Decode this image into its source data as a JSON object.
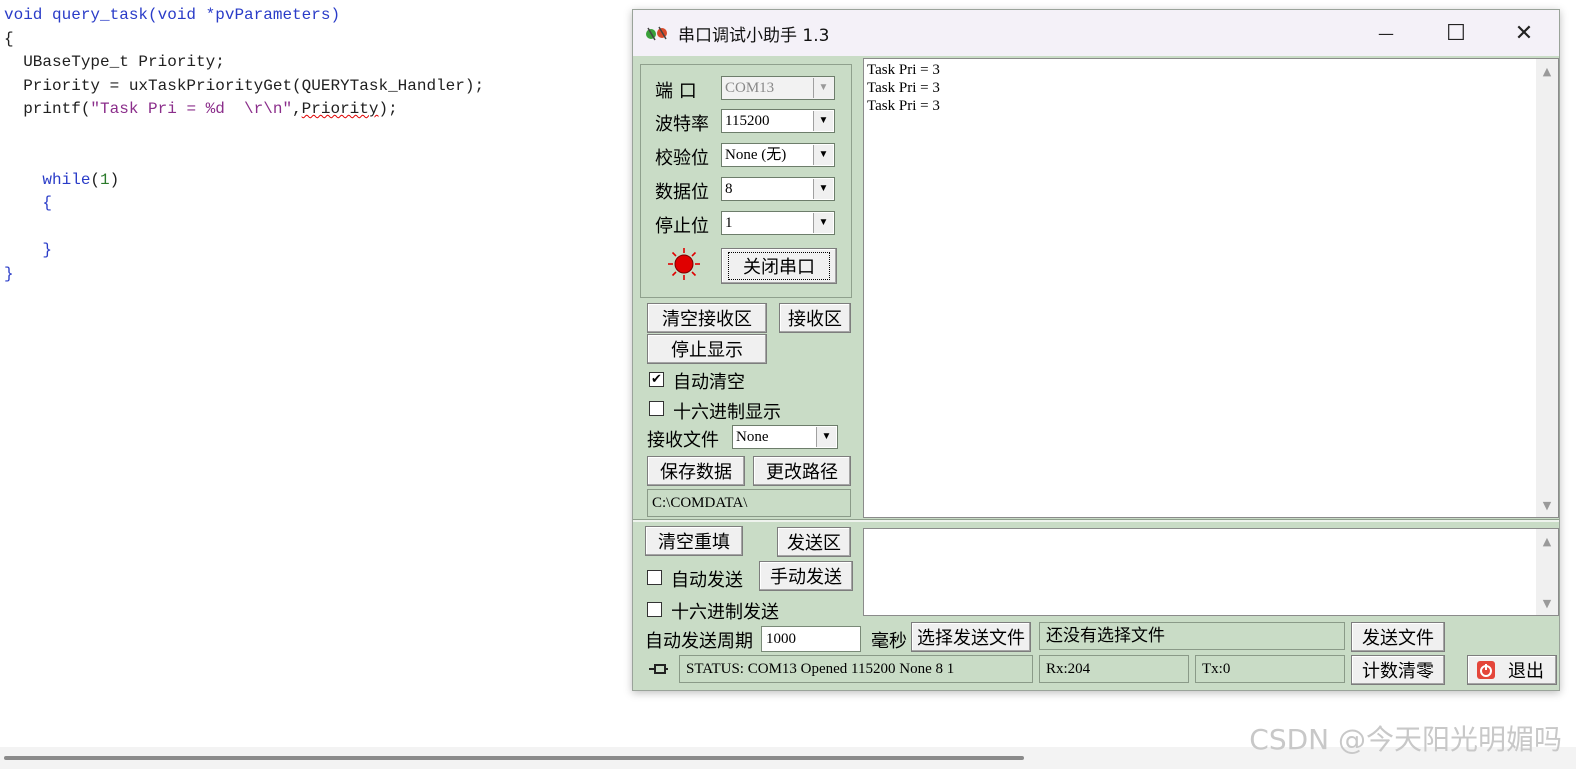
{
  "editor": {
    "line1": "void query_task(void *pvParameters)",
    "line2": "{",
    "line3": "  UBaseType_t Priority;",
    "line4": "  Priority = uxTaskPriorityGet(QUERYTask_Handler);",
    "line5_a": "  printf(",
    "line5_b": "\"Task Pri = %d  \\r\\n\"",
    "line5_c": ",",
    "line5_d": "Priority",
    "line5_e": ");",
    "line8_a": "    ",
    "line8_kw": "while",
    "line8_b": "(",
    "line8_num": "1",
    "line8_c": ")",
    "line9": "    {",
    "line11": "    }",
    "line12": "}"
  },
  "watermark": "CSDN @今天阳光明媚吗",
  "window": {
    "title": "串口调试小助手 1.3",
    "minimize": "—",
    "maximize": "☐",
    "close": "✕"
  },
  "settings": {
    "port_label": "端  口",
    "port_value": "COM13",
    "baud_label": "波特率",
    "baud_value": "115200",
    "parity_label": "校验位",
    "parity_value": "None (无)",
    "databits_label": "数据位",
    "databits_value": "8",
    "stopbits_label": "停止位",
    "stopbits_value": "1",
    "toggle_port_button": "关闭串口"
  },
  "receive": {
    "clear_button": "清空接收区",
    "area_label": "接收区",
    "stop_display_button": "停止显示",
    "auto_clear_label": "自动清空",
    "auto_clear_checked": "✔",
    "hex_display_label": "十六进制显示",
    "file_label": "接收文件",
    "file_value": "None",
    "save_button": "保存数据",
    "change_path_button": "更改路径",
    "path": "C:\\COMDATA\\",
    "output": "Task Pri = 3\nTask Pri = 3\nTask Pri = 3"
  },
  "send": {
    "clear_button": "清空重填",
    "area_label": "发送区",
    "auto_send_label": "自动发送",
    "manual_send_button": "手动发送",
    "hex_send_label": "十六进制发送",
    "period_label": "自动发送周期",
    "period_value": "1000",
    "unit_label": "毫秒",
    "choose_file_button": "选择发送文件",
    "file_status": "还没有选择文件",
    "send_file_button": "发送文件"
  },
  "statusbar": {
    "status": "STATUS: COM13 Opened 115200 None  8 1",
    "rx": "Rx:204",
    "tx": "Tx:0",
    "reset_count_button": "计数清零",
    "exit_button": "退出"
  },
  "colors": {
    "panel": "#c9dcc6",
    "led": "#e00000",
    "keyword": "#2a3cc8",
    "string": "#8b2e8b"
  }
}
